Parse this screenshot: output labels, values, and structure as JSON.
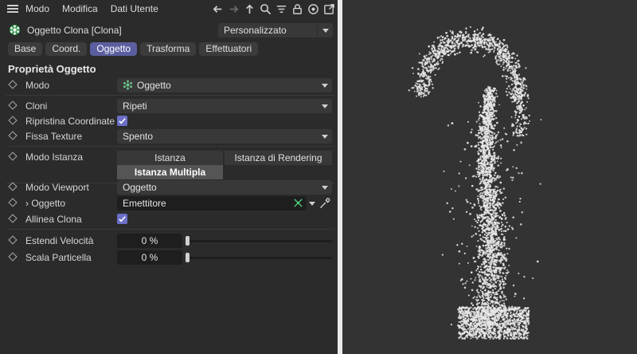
{
  "menubar": {
    "items": [
      "Modo",
      "Modifica",
      "Dati Utente"
    ],
    "tools": [
      "arrow-left-icon",
      "arrow-right-icon",
      "arrow-up-icon",
      "search-icon",
      "filter-icon",
      "lock-icon",
      "target-icon",
      "open-window-icon"
    ]
  },
  "object": {
    "title": "Oggetto Clona [Clona]",
    "preset": "Personalizzato"
  },
  "tabs": [
    {
      "label": "Base",
      "active": false
    },
    {
      "label": "Coord.",
      "active": false
    },
    {
      "label": "Oggetto",
      "active": true
    },
    {
      "label": "Trasforma",
      "active": false
    },
    {
      "label": "Effettuatori",
      "active": false
    }
  ],
  "section_title": "Proprietà Oggetto",
  "fields": {
    "modo": {
      "label": "Modo",
      "value": "Oggetto"
    },
    "cloni": {
      "label": "Cloni",
      "value": "Ripeti"
    },
    "ripristina": {
      "label": "Ripristina Coordinate",
      "checked": true
    },
    "fissa_texture": {
      "label": "Fissa Texture",
      "value": "Spento"
    },
    "modo_istanza": {
      "label": "Modo Istanza",
      "options": [
        "Istanza",
        "Istanza di Rendering",
        "Istanza Multipla"
      ],
      "selected": "Istanza Multipla"
    },
    "modo_viewport": {
      "label": "Modo Viewport",
      "value": "Oggetto"
    },
    "oggetto": {
      "label": "Oggetto",
      "expand": "›",
      "value": "Emettitore"
    },
    "allinea": {
      "label": "Allinea Clona",
      "checked": true
    },
    "estendi_velocita": {
      "label": "Estendi Velocità",
      "value": "0 %",
      "slider": 0
    },
    "scala_particella": {
      "label": "Scala Particella",
      "value": "0 %",
      "slider": 0
    }
  },
  "colors": {
    "accent": "#5b5fa0",
    "checkbox": "#6b6fc8",
    "panel": "#2b2b2b",
    "viewport": "#333333",
    "particles": "#e6e6e6"
  }
}
